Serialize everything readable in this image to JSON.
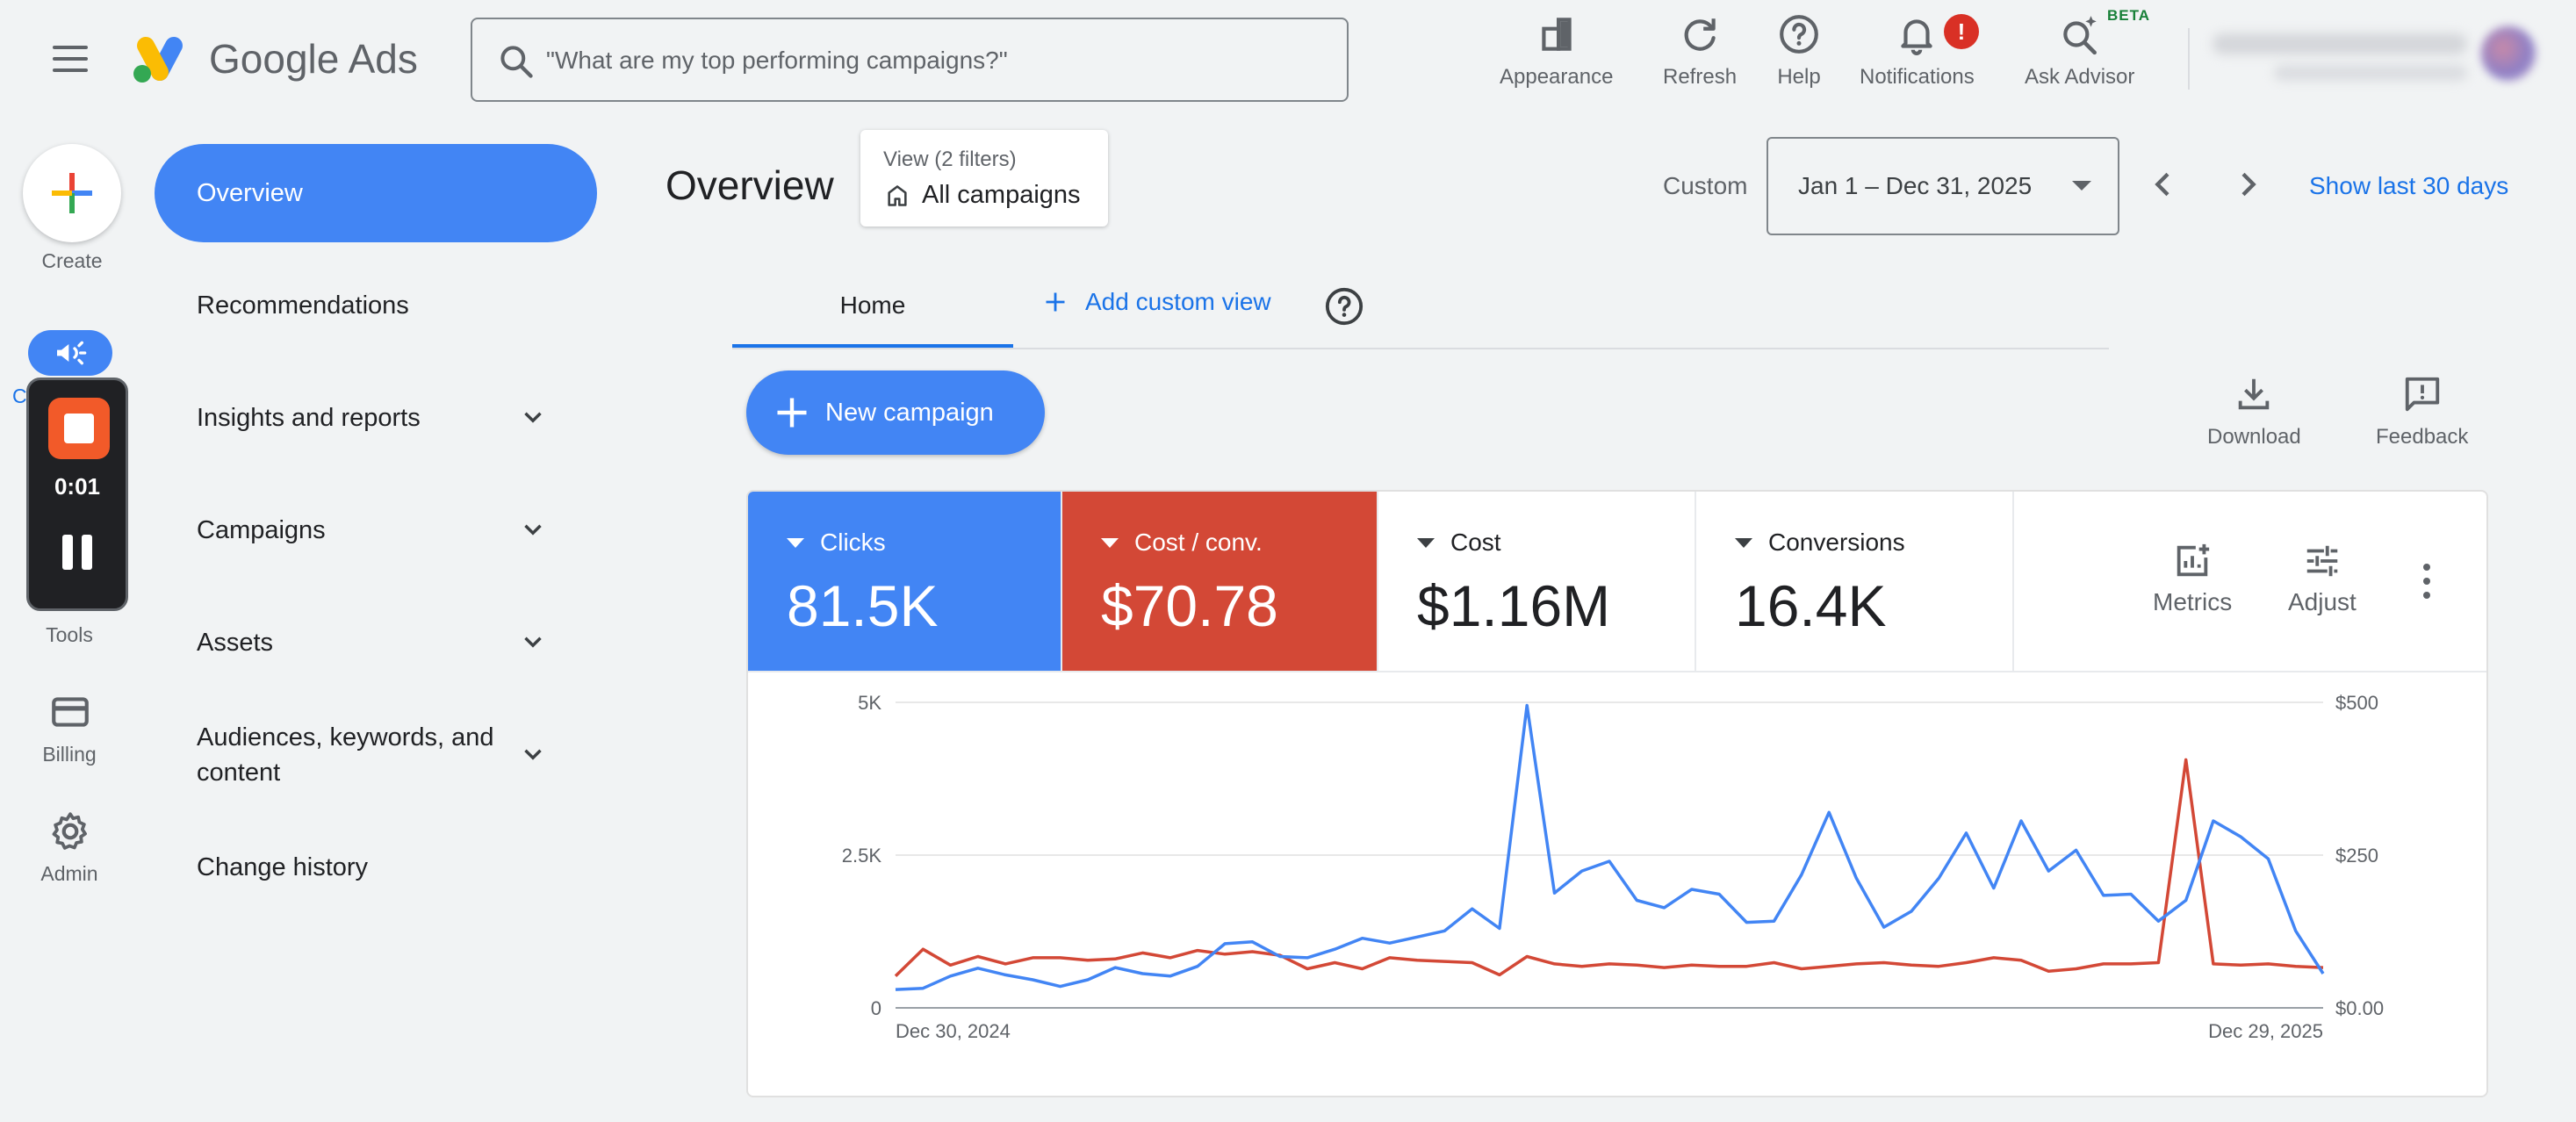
{
  "app": {
    "logo_text": "Google Ads"
  },
  "search": {
    "placeholder": "\"What are my top performing campaigns?\""
  },
  "toolbar": {
    "appearance": "Appearance",
    "refresh": "Refresh",
    "help": "Help",
    "notifications": "Notifications",
    "notifications_badge": "!",
    "ask_advisor": "Ask Advisor",
    "beta": "BETA"
  },
  "rail": {
    "create": "Create",
    "campaigns_partial": "C",
    "recording_time": "0:01",
    "tools": "Tools",
    "billing": "Billing",
    "admin": "Admin"
  },
  "nav": {
    "overview": "Overview",
    "recommendations": "Recommendations",
    "insights": "Insights and reports",
    "campaigns": "Campaigns",
    "assets": "Assets",
    "audiences_line1": "Audiences, keywords, and",
    "audiences_line2": "content",
    "change_history": "Change history"
  },
  "header": {
    "title": "Overview",
    "view_label": "View (2 filters)",
    "view_value": "All campaigns",
    "custom": "Custom",
    "date_range": "Jan 1 – Dec 31, 2025",
    "show_last": "Show last 30 days"
  },
  "tabs": {
    "home": "Home",
    "add_custom_view": "Add custom view"
  },
  "actions": {
    "new_campaign": "New campaign",
    "download": "Download",
    "feedback": "Feedback"
  },
  "metrics": [
    {
      "label": "Clicks",
      "value": "81.5K",
      "color": "#4285f4"
    },
    {
      "label": "Cost / conv.",
      "value": "$70.78",
      "color": "#d34836"
    },
    {
      "label": "Cost",
      "value": "$1.16M",
      "color": "#ffffff"
    },
    {
      "label": "Conversions",
      "value": "16.4K",
      "color": "#ffffff"
    }
  ],
  "card_tools": {
    "metrics": "Metrics",
    "adjust": "Adjust"
  },
  "chart_data": {
    "type": "line",
    "x_start_label": "Dec 30, 2024",
    "x_end_label": "Dec 29, 2025",
    "y_left": {
      "ticks": [
        "0",
        "2.5K",
        "5K"
      ],
      "range": [
        0,
        5000
      ]
    },
    "y_right": {
      "ticks": [
        "$0.00",
        "$250",
        "$500"
      ],
      "range": [
        0,
        500
      ]
    },
    "series": [
      {
        "name": "Clicks",
        "axis": "left",
        "color": "#4285f4",
        "values": [
          300,
          320,
          520,
          650,
          540,
          460,
          350,
          460,
          660,
          560,
          520,
          680,
          1050,
          1080,
          840,
          820,
          960,
          1140,
          1060,
          1160,
          1260,
          1620,
          1300,
          4950,
          1880,
          2240,
          2400,
          1760,
          1640,
          1940,
          1860,
          1400,
          1420,
          2180,
          3200,
          2120,
          1320,
          1580,
          2120,
          2860,
          1960,
          3060,
          2240,
          2580,
          1840,
          1860,
          1420,
          1760,
          3060,
          2800,
          2440,
          1260,
          560
        ]
      },
      {
        "name": "Cost / conv.",
        "axis": "right",
        "color": "#d34836",
        "values": [
          52,
          96,
          70,
          84,
          72,
          82,
          82,
          78,
          80,
          90,
          82,
          94,
          88,
          92,
          86,
          64,
          74,
          64,
          82,
          78,
          76,
          74,
          54,
          84,
          72,
          68,
          72,
          70,
          66,
          70,
          68,
          68,
          74,
          64,
          68,
          72,
          74,
          70,
          68,
          74,
          82,
          78,
          60,
          64,
          72,
          72,
          74,
          406,
          72,
          70,
          72,
          68,
          66
        ]
      }
    ]
  }
}
